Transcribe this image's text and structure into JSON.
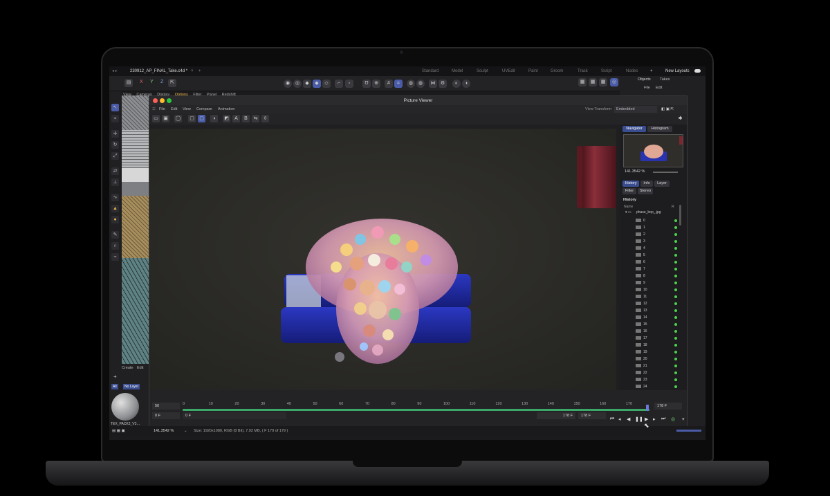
{
  "app": {
    "doc_tab": "230912_AP_FINAL_Take.c4d *",
    "layouts": [
      "Standard",
      "Model",
      "Sculpt",
      "UVEdit",
      "Paint",
      "Groom",
      "Track",
      "Script",
      "Nodes"
    ],
    "new_layouts": "New Layouts",
    "xyz": [
      "X",
      "Y",
      "Z"
    ],
    "viewport_menu": [
      "View",
      "Cameras",
      "Display",
      "Options",
      "Filter",
      "Panel",
      "Redshift"
    ],
    "right_tabs": [
      "Objects",
      "Takes"
    ],
    "right_menu": [
      "File",
      "Edit"
    ]
  },
  "picture_viewer": {
    "title": "Picture Viewer",
    "menu": [
      "File",
      "Edit",
      "View",
      "Compare",
      "Animation"
    ],
    "view_transform_label": "View Transform",
    "view_transform_value": "Embedded",
    "ab": [
      "A",
      "B"
    ],
    "nav_tabs": [
      "Navigator",
      "Histogram"
    ],
    "zoom": "141.3542 %",
    "info_tabs": [
      "History",
      "Info",
      "Layer"
    ],
    "info_tabs2": [
      "Filter",
      "Stereo"
    ],
    "history_heading": "History",
    "col_name": "Name",
    "col_r": "R",
    "folder": "phase_bop_.jpg",
    "frames": [
      "0",
      "1",
      "2",
      "3",
      "4",
      "5",
      "6",
      "7",
      "8",
      "9",
      "10",
      "11",
      "12",
      "13",
      "14",
      "15",
      "16",
      "17",
      "18",
      "19",
      "20",
      "21",
      "22",
      "23",
      "24"
    ]
  },
  "timeline": {
    "ticks": [
      "0",
      "10",
      "20",
      "30",
      "40",
      "50",
      "60",
      "70",
      "80",
      "90",
      "100",
      "110",
      "120",
      "130",
      "140",
      "150",
      "160",
      "170"
    ],
    "field_top_left": "50",
    "field_bottom_left": "0 F",
    "field_bottom_left2": "0 F",
    "field_end_a": "178 F",
    "field_end_b": "178 F",
    "field_end_c": "178 F",
    "playhead_frame": 178
  },
  "status": {
    "zoom": "141.3542 %",
    "info": "Size: 1920x1080, RGB (8 Bit), 7.92 MB,  ( F 179 of 179 )"
  },
  "left_panel": {
    "menu": [
      "Create",
      "Edit"
    ],
    "filters": [
      "All",
      "No Layer"
    ],
    "material_name": "TEX_PACK2_V3…"
  },
  "colors": {
    "accent": "#3a4d8e",
    "track": "#3ba86a",
    "status_green": "#4bd34b"
  }
}
